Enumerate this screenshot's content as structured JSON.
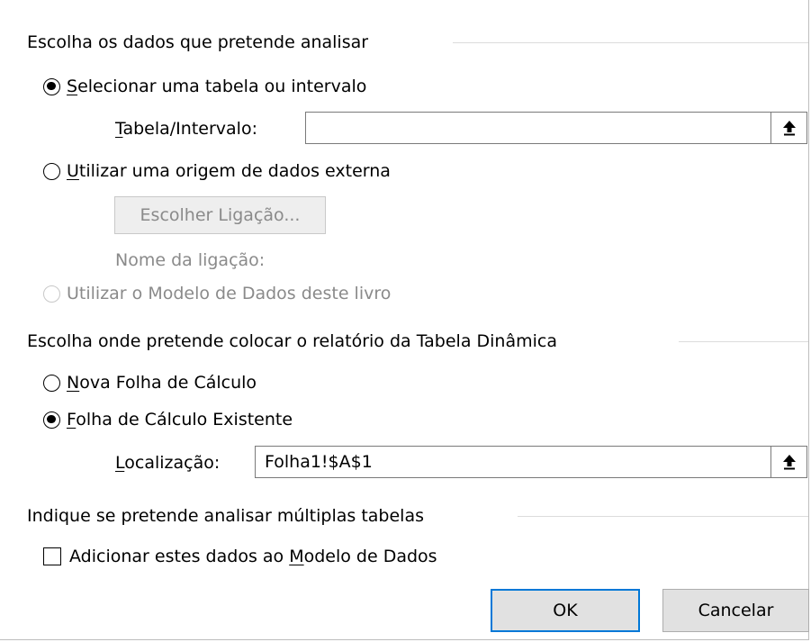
{
  "source_section": {
    "title": "Escolha os dados que pretende analisar",
    "option_table": {
      "accel": "S",
      "rest": "elecionar uma tabela ou intervalo",
      "selected": true
    },
    "table_range": {
      "label_accel": "T",
      "label_rest": "abela/Intervalo:",
      "value": "",
      "collapse_icon": "arrow-up-icon"
    },
    "option_external": {
      "accel": "U",
      "rest": "tilizar uma origem de dados externa",
      "selected": false
    },
    "choose_connection_button": "Escolher Ligação...",
    "connection_name_label": "Nome da ligação:",
    "option_data_model": {
      "label": "Utilizar o Modelo de Dados deste livro",
      "selected": false,
      "disabled": true
    }
  },
  "destination_section": {
    "title": "Escolha onde pretende colocar o relatório da Tabela Dinâmica",
    "option_new_sheet": {
      "accel": "N",
      "rest": "ova Folha de Cálculo",
      "selected": false
    },
    "option_existing_sheet": {
      "accel": "F",
      "rest": "olha de Cálculo Existente",
      "selected": true
    },
    "location": {
      "label_accel": "L",
      "label_rest": "ocalização:",
      "value": "Folha1!$A$1",
      "collapse_icon": "arrow-up-icon"
    }
  },
  "multiple_tables_section": {
    "title": "Indique se pretende analisar múltiplas tabelas",
    "add_to_model": {
      "before": "Adicionar estes dados ao ",
      "accel": "M",
      "after": "odelo de Dados",
      "checked": false
    }
  },
  "buttons": {
    "ok": "OK",
    "cancel": "Cancelar"
  },
  "colors": {
    "default_button_border": "#0078d7",
    "disabled_text": "#8a8a8a"
  }
}
